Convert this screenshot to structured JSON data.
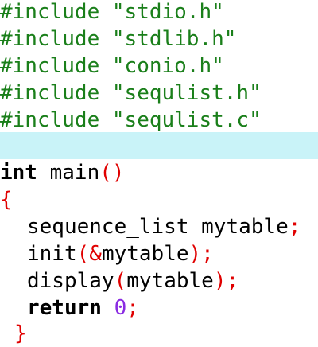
{
  "editor": {
    "lines": [
      {
        "directive": "#include",
        "file": "\"stdio.h\""
      },
      {
        "directive": "#include",
        "file": "\"stdlib.h\""
      },
      {
        "directive": "#include",
        "file": "\"conio.h\""
      },
      {
        "directive": "#include",
        "file": "\"sequlist.h\""
      },
      {
        "directive": "#include",
        "file": "\"sequlist.c\""
      }
    ],
    "main_sig": {
      "kw": "int",
      "name": "main",
      "parens": "()"
    },
    "open_brace": "{",
    "body": {
      "decl": {
        "type": "sequence_list",
        "var": "mytable",
        "semi": ";"
      },
      "init": {
        "fn": "init",
        "lparen": "(",
        "amp": "&",
        "arg": "mytable",
        "rparen": ")",
        "semi": ";"
      },
      "display": {
        "fn": "display",
        "lparen": "(",
        "arg": "mytable",
        "rparen": ")",
        "semi": ";"
      },
      "ret": {
        "kw": "return",
        "val": "0",
        "semi": ";"
      }
    },
    "close_brace": "}"
  }
}
